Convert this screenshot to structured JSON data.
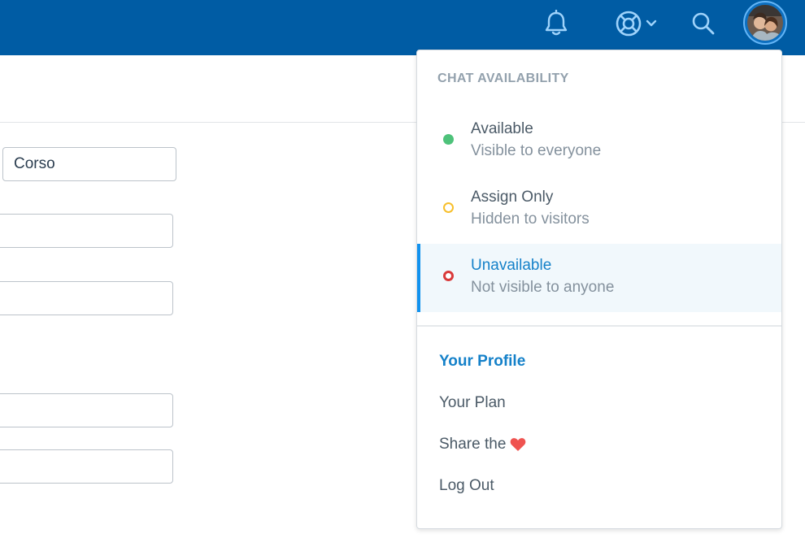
{
  "header": {
    "icons": [
      "bell-icon",
      "lifebuoy-icon",
      "chevron-down-icon",
      "search-icon"
    ],
    "brand_color": "#005ca4"
  },
  "form": {
    "last_name_value": "Corso",
    "field_2_value": "",
    "field_3_value": "",
    "field_4_value": "",
    "field_5_value": ""
  },
  "dropdown": {
    "heading": "CHAT AVAILABILITY",
    "statuses": [
      {
        "label": "Available",
        "sub": "Visible to everyone",
        "color": "#4ec27a"
      },
      {
        "label": "Assign Only",
        "sub": "Hidden to visitors",
        "color": "#f7bf2b"
      },
      {
        "label": "Unavailable",
        "sub": "Not visible to anyone",
        "color": "#d93a3a",
        "selected": true
      }
    ],
    "links": {
      "profile": "Your Profile",
      "plan": "Your Plan",
      "share": "Share the",
      "logout": "Log Out"
    },
    "share_icon": "heart-icon",
    "accent_color": "#1581c9"
  }
}
